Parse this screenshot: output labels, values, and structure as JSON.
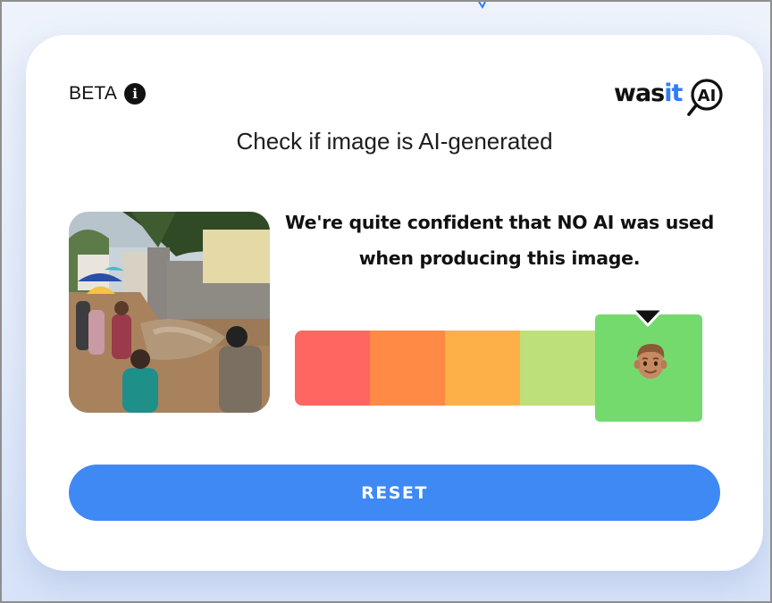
{
  "header": {
    "beta_label": "BETA",
    "info_icon": "info-icon",
    "logo": {
      "text_main": "was",
      "text_accent": "it",
      "mark_text": "AI"
    }
  },
  "title": "Check if image is AI-generated",
  "result": {
    "verdict_line1": "We're quite confident that NO AI was used",
    "verdict_line2": "when producing this image.",
    "scale_colors": [
      "#fe6661",
      "#fe8a45",
      "#feb048",
      "#bde07a",
      "#74da6e"
    ],
    "selected_level": 5,
    "level_count": 5,
    "marker_icon": "person-face-icon"
  },
  "actions": {
    "reset_label": "RESET"
  },
  "colors": {
    "accent": "#3f89f5",
    "logo_accent": "#2f7df6",
    "card_background": "#ffffff"
  }
}
